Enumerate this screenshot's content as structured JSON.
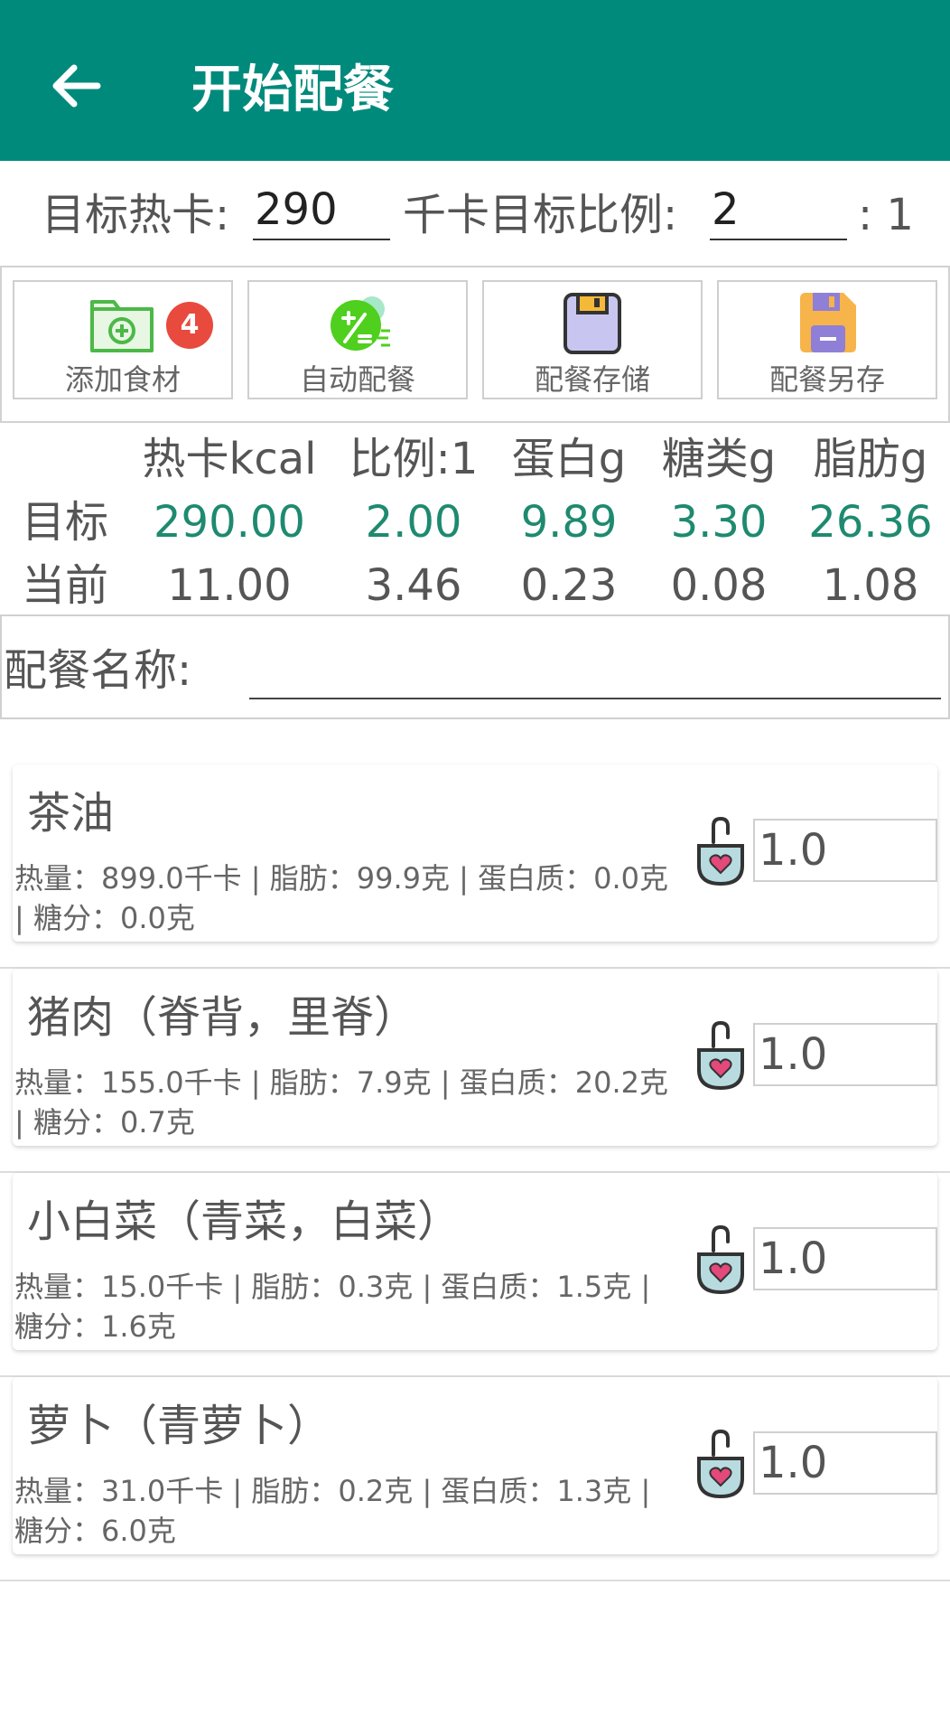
{
  "header": {
    "title": "开始配餐"
  },
  "targets": {
    "calorie_label": "目标热卡:",
    "calorie_value": "290",
    "ratio_label": "千卡目标比例:",
    "ratio_value": "2",
    "ratio_suffix": ": 1"
  },
  "toolbar": {
    "add": {
      "label": "添加食材",
      "badge": "4"
    },
    "auto": {
      "label": "自动配餐"
    },
    "save": {
      "label": "配餐存储"
    },
    "save_as": {
      "label": "配餐另存"
    }
  },
  "nutrition": {
    "headers": [
      "热卡kcal",
      "比例:1",
      "蛋白g",
      "糖类g",
      "脂肪g"
    ],
    "target_label": "目标",
    "target_values": [
      "290.00",
      "2.00",
      "9.89",
      "3.30",
      "26.36"
    ],
    "current_label": "当前",
    "current_values": [
      "11.00",
      "3.46",
      "0.23",
      "0.08",
      "1.08"
    ],
    "target_color": "#1e8a70"
  },
  "meal_name": {
    "label": "配餐名称:",
    "value": ""
  },
  "foods": [
    {
      "name": "茶油",
      "info": "热量：899.0千卡 | 脂肪：99.9克 | 蛋白质：0.0克 | 糖分：0.0克",
      "qty": "1.0"
    },
    {
      "name": "猪肉（脊背，里脊）",
      "info": "热量：155.0千卡 | 脂肪：7.9克 | 蛋白质：20.2克 | 糖分：0.7克",
      "qty": "1.0"
    },
    {
      "name": "小白菜（青菜，白菜）",
      "info": "热量：15.0千卡 | 脂肪：0.3克 | 蛋白质：1.5克 | 糖分：1.6克",
      "qty": "1.0"
    },
    {
      "name": "萝卜（青萝卜）",
      "info": "热量：31.0千卡 | 脂肪：0.2克 | 蛋白质：1.3克 | 糖分：6.0克",
      "qty": "1.0"
    }
  ],
  "colors": {
    "appbar": "#008a7c",
    "accent_green": "#1e8a70",
    "badge_red": "#e84a3e"
  }
}
